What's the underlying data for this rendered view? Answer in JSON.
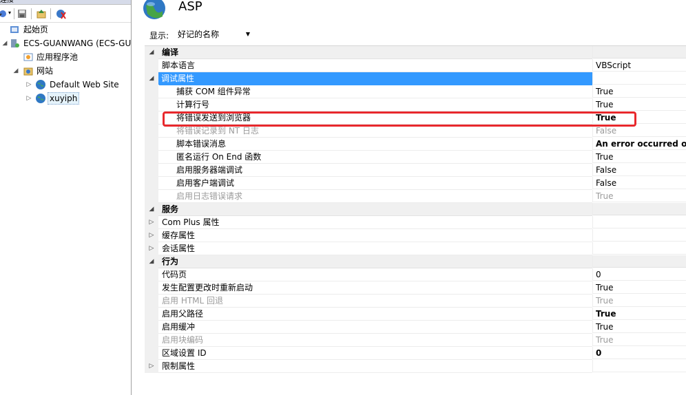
{
  "left_panel": {
    "title": "连接",
    "tree": [
      {
        "label": "起始页",
        "icon": "start-page-icon",
        "expander": ""
      },
      {
        "label": "ECS-GUANWANG (ECS-GU",
        "icon": "server-icon",
        "expander": "◢"
      },
      {
        "label": "应用程序池",
        "icon": "app-pool-icon",
        "expander": ""
      },
      {
        "label": "网站",
        "icon": "sites-folder-icon",
        "expander": "◢"
      },
      {
        "label": "Default Web Site",
        "icon": "globe-icon",
        "expander": "▷"
      },
      {
        "label": "xuyiph",
        "icon": "globe-icon",
        "expander": "▷"
      }
    ]
  },
  "header": {
    "title": "ASP",
    "icon": "asp-globe-icon"
  },
  "display": {
    "label": "显示:",
    "value": "好记的名称"
  },
  "grid": {
    "rows": [
      {
        "kind": "category",
        "gutter": "◢",
        "name": "编译",
        "value": ""
      },
      {
        "kind": "prop",
        "gutter": "",
        "name": "脚本语言",
        "value": "VBScript",
        "indent": 1
      },
      {
        "kind": "sub",
        "gutter": "◢",
        "name": "调试属性",
        "value": "",
        "selected": true
      },
      {
        "kind": "prop",
        "gutter": "",
        "name": "捕获 COM 组件异常",
        "value": "True",
        "indent": 2
      },
      {
        "kind": "prop",
        "gutter": "",
        "name": "计算行号",
        "value": "True",
        "indent": 2
      },
      {
        "kind": "prop",
        "gutter": "",
        "name": "将错误发送到浏览器",
        "value": "True",
        "indent": 2,
        "bold": true
      },
      {
        "kind": "prop",
        "gutter": "",
        "name": "将错误记录到 NT 日志",
        "value": "False",
        "indent": 2,
        "dim": true
      },
      {
        "kind": "prop",
        "gutter": "",
        "name": "脚本错误消息",
        "value": "An error occurred on",
        "indent": 2,
        "bold": true
      },
      {
        "kind": "prop",
        "gutter": "",
        "name": "匿名运行 On End 函数",
        "value": "True",
        "indent": 2
      },
      {
        "kind": "prop",
        "gutter": "",
        "name": "启用服务器端调试",
        "value": "False",
        "indent": 2
      },
      {
        "kind": "prop",
        "gutter": "",
        "name": "启用客户端调试",
        "value": "False",
        "indent": 2
      },
      {
        "kind": "prop",
        "gutter": "",
        "name": "启用日志错误请求",
        "value": "True",
        "indent": 2,
        "dim": true
      },
      {
        "kind": "category",
        "gutter": "◢",
        "name": "服务",
        "value": ""
      },
      {
        "kind": "sub",
        "gutter": "▷",
        "name": "Com Plus 属性",
        "value": ""
      },
      {
        "kind": "sub",
        "gutter": "▷",
        "name": "缓存属性",
        "value": ""
      },
      {
        "kind": "sub",
        "gutter": "▷",
        "name": "会话属性",
        "value": ""
      },
      {
        "kind": "category",
        "gutter": "◢",
        "name": "行为",
        "value": ""
      },
      {
        "kind": "prop",
        "gutter": "",
        "name": "代码页",
        "value": "0",
        "indent": 1
      },
      {
        "kind": "prop",
        "gutter": "",
        "name": "发生配置更改时重新启动",
        "value": "True",
        "indent": 1
      },
      {
        "kind": "prop",
        "gutter": "",
        "name": "启用 HTML 回退",
        "value": "True",
        "indent": 1,
        "dim": true
      },
      {
        "kind": "prop",
        "gutter": "",
        "name": "启用父路径",
        "value": "True",
        "indent": 1,
        "bold": true
      },
      {
        "kind": "prop",
        "gutter": "",
        "name": "启用缓冲",
        "value": "True",
        "indent": 1
      },
      {
        "kind": "prop",
        "gutter": "",
        "name": "启用块编码",
        "value": "True",
        "indent": 1,
        "dim": true
      },
      {
        "kind": "prop",
        "gutter": "",
        "name": "区域设置 ID",
        "value": "0",
        "indent": 1,
        "bold_value": true
      },
      {
        "kind": "sub",
        "gutter": "▷",
        "name": "限制属性",
        "value": ""
      }
    ]
  },
  "colors": {
    "selection": "#3399ff",
    "highlight_box": "#e8282c",
    "category_bg": "#f0f0f0"
  }
}
